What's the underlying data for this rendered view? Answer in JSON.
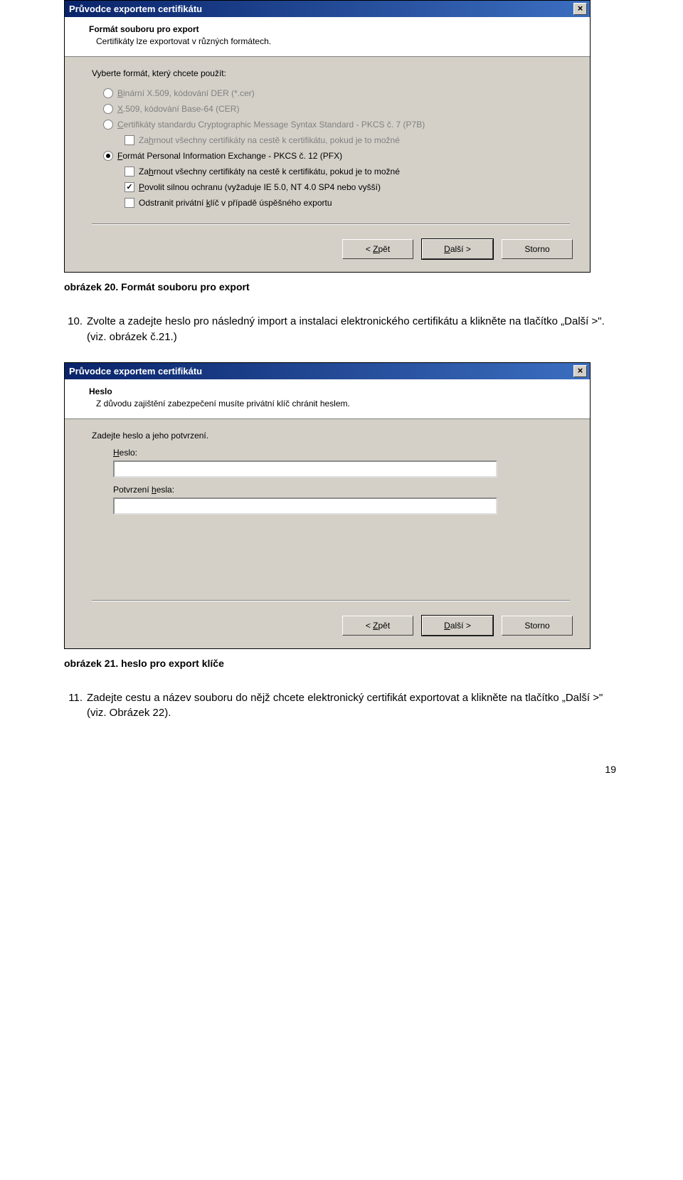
{
  "dialog1": {
    "title": "Průvodce exportem certifikátu",
    "header_title": "Formát souboru pro export",
    "header_sub": "Certifikáty lze exportovat v různých formátech.",
    "prompt": "Vyberte formát, který chcete použít:",
    "options": {
      "o1": {
        "pre": "B",
        "rest": "inární X.509, kódování DER (*.cer)"
      },
      "o2": {
        "pre": "X",
        "rest": ".509, kódování Base-64 (CER)"
      },
      "o3": {
        "pre": "C",
        "rest": "ertifikáty standardu Cryptographic Message Syntax Standard - PKCS č. 7 (P7B)"
      },
      "o3c": {
        "pre": "Za",
        "u": "h",
        "rest": "rnout všechny certifikáty na cestě k certifikátu, pokud je to možné"
      },
      "o4": {
        "pre": "F",
        "rest": "ormát Personal Information Exchange - PKCS č. 12 (PFX)"
      },
      "o4a": {
        "pre": "Za",
        "u": "h",
        "rest": "rnout všechny certifikáty na cestě k certifikátu, pokud je to možné"
      },
      "o4b": {
        "pre": "",
        "u": "P",
        "rest": "ovolit silnou ochranu (vyžaduje IE 5.0, NT 4.0 SP4 nebo vyšší)"
      },
      "o4c": {
        "pre": "Odstranit privátní ",
        "u": "k",
        "rest": "líč v případě úspěšného exportu"
      }
    },
    "buttons": {
      "back_pre": "< ",
      "back_u": "Z",
      "back_rest": "pět",
      "next_pre": "",
      "next_u": "D",
      "next_rest": "alší >",
      "cancel": "Storno"
    }
  },
  "caption1": "obrázek 20. Formát souboru pro export",
  "para1_num": "10.",
  "para1": "Zvolte a zadejte heslo pro následný import a instalaci elektronického certifikátu a klikněte na tlačítko „Další >\". (viz. obrázek č.21.)",
  "dialog2": {
    "title": "Průvodce exportem certifikátu",
    "header_title": "Heslo",
    "header_sub": "Z důvodu zajištění zabezpečení musíte privátní klíč chránit heslem.",
    "prompt": "Zadejte heslo a jeho potvrzení.",
    "label_pw_pre": "",
    "label_pw_u": "H",
    "label_pw_rest": "eslo:",
    "label_cpw_pre": "Potvrzení ",
    "label_cpw_u": "h",
    "label_cpw_rest": "esla:",
    "buttons": {
      "back_pre": "< ",
      "back_u": "Z",
      "back_rest": "pět",
      "next_pre": "",
      "next_u": "D",
      "next_rest": "alší >",
      "cancel": "Storno"
    }
  },
  "caption2": "obrázek 21. heslo pro export klíče",
  "para2_num": "11.",
  "para2": "Zadejte cestu a název souboru do nějž chcete elektronický certifikát exportovat a klikněte na tlačítko „Další >\" (viz. Obrázek 22).",
  "page_num": "19"
}
